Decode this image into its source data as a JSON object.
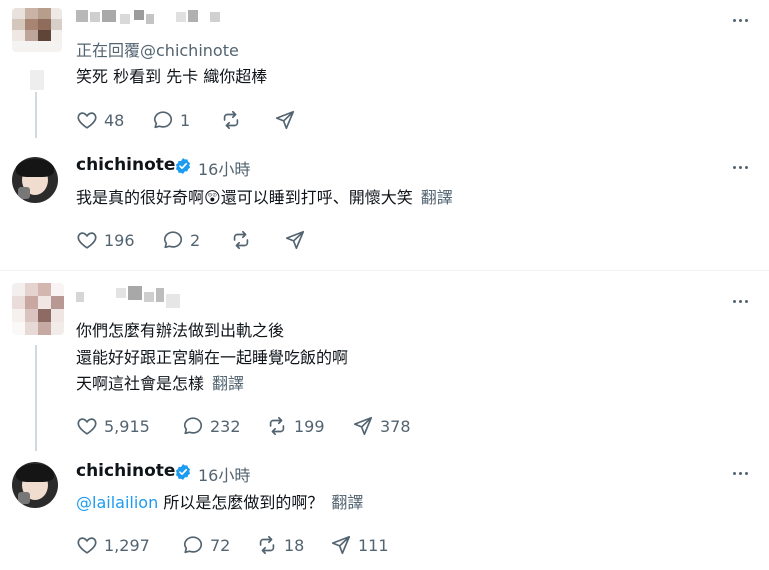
{
  "comment1": {
    "replying_to": "正在回覆@chichinote",
    "text": "笑死 秒看到 先卡 織你超棒",
    "likes": "48",
    "replies": "1"
  },
  "reply1": {
    "name": "chichinote",
    "time": "16小時",
    "text_before": "我是真的很好奇啊",
    "emoji": "😲",
    "text_after": "還可以睡到打呼、開懷大笑",
    "translate": "翻譯",
    "likes": "196",
    "replies": "2"
  },
  "comment2": {
    "lines": [
      "你們怎麼有辦法做到出軌之後",
      "還能好好跟正宮躺在一起睡覺吃飯的啊",
      "天啊這社會是怎樣"
    ],
    "translate": "翻譯",
    "likes": "5,915",
    "replies": "232",
    "reposts": "199",
    "shares": "378"
  },
  "reply2": {
    "name": "chichinote",
    "time": "16小時",
    "mention": "@lailailion",
    "text": "所以是怎麼做到的啊？",
    "translate": "翻譯",
    "likes": "1,297",
    "replies": "72",
    "reposts": "18",
    "shares": "111"
  },
  "colors": {
    "accent": "#1d9bf0",
    "muted": "#536471",
    "text": "#0f1419"
  }
}
